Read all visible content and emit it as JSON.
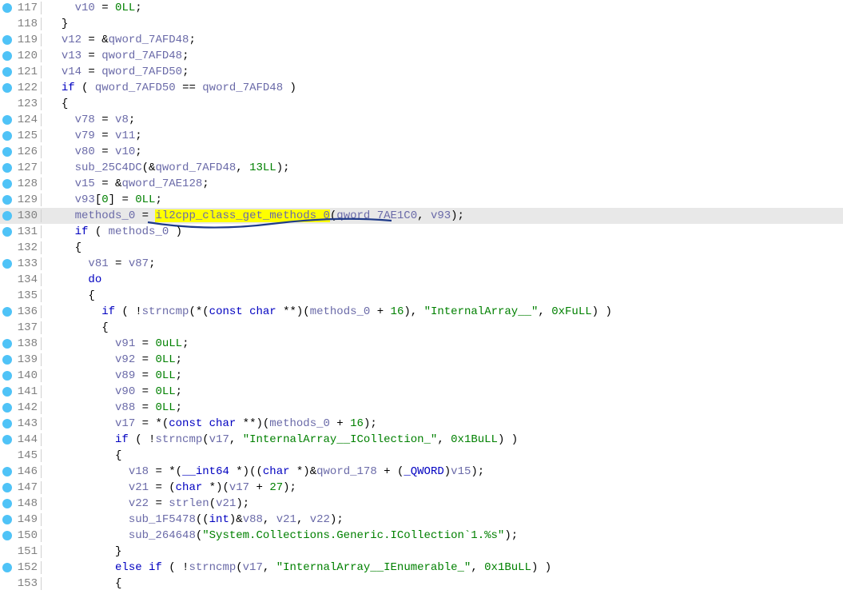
{
  "lines": [
    {
      "num": "117",
      "bp": true,
      "indent": "    ",
      "tokens": [
        {
          "t": "var",
          "v": "v10"
        },
        {
          "t": "op",
          "v": " = "
        },
        {
          "t": "num",
          "v": "0LL"
        },
        {
          "t": "pun",
          "v": ";"
        }
      ]
    },
    {
      "num": "118",
      "bp": false,
      "indent": "  ",
      "tokens": [
        {
          "t": "pun",
          "v": "}"
        }
      ]
    },
    {
      "num": "119",
      "bp": true,
      "indent": "  ",
      "tokens": [
        {
          "t": "var",
          "v": "v12"
        },
        {
          "t": "op",
          "v": " = &"
        },
        {
          "t": "var",
          "v": "qword_7AFD48"
        },
        {
          "t": "pun",
          "v": ";"
        }
      ]
    },
    {
      "num": "120",
      "bp": true,
      "indent": "  ",
      "tokens": [
        {
          "t": "var",
          "v": "v13"
        },
        {
          "t": "op",
          "v": " = "
        },
        {
          "t": "var",
          "v": "qword_7AFD48"
        },
        {
          "t": "pun",
          "v": ";"
        }
      ]
    },
    {
      "num": "121",
      "bp": true,
      "indent": "  ",
      "tokens": [
        {
          "t": "var",
          "v": "v14"
        },
        {
          "t": "op",
          "v": " = "
        },
        {
          "t": "var",
          "v": "qword_7AFD50"
        },
        {
          "t": "pun",
          "v": ";"
        }
      ]
    },
    {
      "num": "122",
      "bp": true,
      "indent": "  ",
      "tokens": [
        {
          "t": "kw",
          "v": "if"
        },
        {
          "t": "op",
          "v": " ( "
        },
        {
          "t": "var",
          "v": "qword_7AFD50"
        },
        {
          "t": "op",
          "v": " == "
        },
        {
          "t": "var",
          "v": "qword_7AFD48"
        },
        {
          "t": "op",
          "v": " )"
        }
      ]
    },
    {
      "num": "123",
      "bp": false,
      "indent": "  ",
      "tokens": [
        {
          "t": "pun",
          "v": "{"
        }
      ]
    },
    {
      "num": "124",
      "bp": true,
      "indent": "    ",
      "tokens": [
        {
          "t": "var",
          "v": "v78"
        },
        {
          "t": "op",
          "v": " = "
        },
        {
          "t": "var",
          "v": "v8"
        },
        {
          "t": "pun",
          "v": ";"
        }
      ]
    },
    {
      "num": "125",
      "bp": true,
      "indent": "    ",
      "tokens": [
        {
          "t": "var",
          "v": "v79"
        },
        {
          "t": "op",
          "v": " = "
        },
        {
          "t": "var",
          "v": "v11"
        },
        {
          "t": "pun",
          "v": ";"
        }
      ]
    },
    {
      "num": "126",
      "bp": true,
      "indent": "    ",
      "tokens": [
        {
          "t": "var",
          "v": "v80"
        },
        {
          "t": "op",
          "v": " = "
        },
        {
          "t": "var",
          "v": "v10"
        },
        {
          "t": "pun",
          "v": ";"
        }
      ]
    },
    {
      "num": "127",
      "bp": true,
      "indent": "    ",
      "tokens": [
        {
          "t": "fn",
          "v": "sub_25C4DC"
        },
        {
          "t": "pun",
          "v": "(&"
        },
        {
          "t": "var",
          "v": "qword_7AFD48"
        },
        {
          "t": "pun",
          "v": ", "
        },
        {
          "t": "num",
          "v": "13LL"
        },
        {
          "t": "pun",
          "v": ");"
        }
      ]
    },
    {
      "num": "128",
      "bp": true,
      "indent": "    ",
      "tokens": [
        {
          "t": "var",
          "v": "v15"
        },
        {
          "t": "op",
          "v": " = &"
        },
        {
          "t": "var",
          "v": "qword_7AE128"
        },
        {
          "t": "pun",
          "v": ";"
        }
      ]
    },
    {
      "num": "129",
      "bp": true,
      "indent": "    ",
      "tokens": [
        {
          "t": "var",
          "v": "v93"
        },
        {
          "t": "pun",
          "v": "["
        },
        {
          "t": "num",
          "v": "0"
        },
        {
          "t": "pun",
          "v": "] = "
        },
        {
          "t": "num",
          "v": "0LL"
        },
        {
          "t": "pun",
          "v": ";"
        }
      ]
    },
    {
      "num": "130",
      "bp": true,
      "highlighted": true,
      "indent": "    ",
      "tokens": [
        {
          "t": "var",
          "v": "methods_0"
        },
        {
          "t": "op",
          "v": " = "
        },
        {
          "t": "fn",
          "v": "il2cpp_class_get_methods_0",
          "hl": true
        },
        {
          "t": "pun",
          "v": "("
        },
        {
          "t": "var",
          "v": "qword_7AE1C0"
        },
        {
          "t": "pun",
          "v": ", "
        },
        {
          "t": "var",
          "v": "v93"
        },
        {
          "t": "pun",
          "v": ");"
        }
      ],
      "underline": true
    },
    {
      "num": "131",
      "bp": true,
      "indent": "    ",
      "tokens": [
        {
          "t": "kw",
          "v": "if"
        },
        {
          "t": "op",
          "v": " ( "
        },
        {
          "t": "var",
          "v": "methods_0"
        },
        {
          "t": "op",
          "v": " )"
        }
      ]
    },
    {
      "num": "132",
      "bp": false,
      "indent": "    ",
      "tokens": [
        {
          "t": "pun",
          "v": "{"
        }
      ]
    },
    {
      "num": "133",
      "bp": true,
      "indent": "      ",
      "tokens": [
        {
          "t": "var",
          "v": "v81"
        },
        {
          "t": "op",
          "v": " = "
        },
        {
          "t": "var",
          "v": "v87"
        },
        {
          "t": "pun",
          "v": ";"
        }
      ]
    },
    {
      "num": "134",
      "bp": false,
      "indent": "      ",
      "tokens": [
        {
          "t": "kw",
          "v": "do"
        }
      ]
    },
    {
      "num": "135",
      "bp": false,
      "indent": "      ",
      "tokens": [
        {
          "t": "pun",
          "v": "{"
        }
      ]
    },
    {
      "num": "136",
      "bp": true,
      "indent": "        ",
      "tokens": [
        {
          "t": "kw",
          "v": "if"
        },
        {
          "t": "op",
          "v": " ( !"
        },
        {
          "t": "fn",
          "v": "strncmp"
        },
        {
          "t": "pun",
          "v": "(*("
        },
        {
          "t": "type",
          "v": "const char"
        },
        {
          "t": "pun",
          "v": " **)("
        },
        {
          "t": "var",
          "v": "methods_0"
        },
        {
          "t": "op",
          "v": " + "
        },
        {
          "t": "num",
          "v": "16"
        },
        {
          "t": "pun",
          "v": "), "
        },
        {
          "t": "str",
          "v": "\"InternalArray__\""
        },
        {
          "t": "pun",
          "v": ", "
        },
        {
          "t": "num",
          "v": "0xFuLL"
        },
        {
          "t": "pun",
          "v": ") )"
        }
      ]
    },
    {
      "num": "137",
      "bp": false,
      "indent": "        ",
      "tokens": [
        {
          "t": "pun",
          "v": "{"
        }
      ]
    },
    {
      "num": "138",
      "bp": true,
      "indent": "          ",
      "tokens": [
        {
          "t": "var",
          "v": "v91"
        },
        {
          "t": "op",
          "v": " = "
        },
        {
          "t": "num",
          "v": "0uLL"
        },
        {
          "t": "pun",
          "v": ";"
        }
      ]
    },
    {
      "num": "139",
      "bp": true,
      "indent": "          ",
      "tokens": [
        {
          "t": "var",
          "v": "v92"
        },
        {
          "t": "op",
          "v": " = "
        },
        {
          "t": "num",
          "v": "0LL"
        },
        {
          "t": "pun",
          "v": ";"
        }
      ]
    },
    {
      "num": "140",
      "bp": true,
      "indent": "          ",
      "tokens": [
        {
          "t": "var",
          "v": "v89"
        },
        {
          "t": "op",
          "v": " = "
        },
        {
          "t": "num",
          "v": "0LL"
        },
        {
          "t": "pun",
          "v": ";"
        }
      ]
    },
    {
      "num": "141",
      "bp": true,
      "indent": "          ",
      "tokens": [
        {
          "t": "var",
          "v": "v90"
        },
        {
          "t": "op",
          "v": " = "
        },
        {
          "t": "num",
          "v": "0LL"
        },
        {
          "t": "pun",
          "v": ";"
        }
      ]
    },
    {
      "num": "142",
      "bp": true,
      "indent": "          ",
      "tokens": [
        {
          "t": "var",
          "v": "v88"
        },
        {
          "t": "op",
          "v": " = "
        },
        {
          "t": "num",
          "v": "0LL"
        },
        {
          "t": "pun",
          "v": ";"
        }
      ]
    },
    {
      "num": "143",
      "bp": true,
      "indent": "          ",
      "tokens": [
        {
          "t": "var",
          "v": "v17"
        },
        {
          "t": "op",
          "v": " = *("
        },
        {
          "t": "type",
          "v": "const char"
        },
        {
          "t": "pun",
          "v": " **)("
        },
        {
          "t": "var",
          "v": "methods_0"
        },
        {
          "t": "op",
          "v": " + "
        },
        {
          "t": "num",
          "v": "16"
        },
        {
          "t": "pun",
          "v": ");"
        }
      ]
    },
    {
      "num": "144",
      "bp": true,
      "indent": "          ",
      "tokens": [
        {
          "t": "kw",
          "v": "if"
        },
        {
          "t": "op",
          "v": " ( !"
        },
        {
          "t": "fn",
          "v": "strncmp"
        },
        {
          "t": "pun",
          "v": "("
        },
        {
          "t": "var",
          "v": "v17"
        },
        {
          "t": "pun",
          "v": ", "
        },
        {
          "t": "str",
          "v": "\"InternalArray__ICollection_\""
        },
        {
          "t": "pun",
          "v": ", "
        },
        {
          "t": "num",
          "v": "0x1BuLL"
        },
        {
          "t": "pun",
          "v": ") )"
        }
      ]
    },
    {
      "num": "145",
      "bp": false,
      "indent": "          ",
      "tokens": [
        {
          "t": "pun",
          "v": "{"
        }
      ]
    },
    {
      "num": "146",
      "bp": true,
      "indent": "            ",
      "tokens": [
        {
          "t": "var",
          "v": "v18"
        },
        {
          "t": "op",
          "v": " = *("
        },
        {
          "t": "type",
          "v": "__int64"
        },
        {
          "t": "pun",
          "v": " *)(("
        },
        {
          "t": "type",
          "v": "char"
        },
        {
          "t": "pun",
          "v": " *)&"
        },
        {
          "t": "var",
          "v": "qword_178"
        },
        {
          "t": "pun",
          "v": " + ("
        },
        {
          "t": "type",
          "v": "_QWORD"
        },
        {
          "t": "pun",
          "v": ")"
        },
        {
          "t": "var",
          "v": "v15"
        },
        {
          "t": "pun",
          "v": ");"
        }
      ]
    },
    {
      "num": "147",
      "bp": true,
      "indent": "            ",
      "tokens": [
        {
          "t": "var",
          "v": "v21"
        },
        {
          "t": "op",
          "v": " = ("
        },
        {
          "t": "type",
          "v": "char"
        },
        {
          "t": "pun",
          "v": " *)("
        },
        {
          "t": "var",
          "v": "v17"
        },
        {
          "t": "op",
          "v": " + "
        },
        {
          "t": "num",
          "v": "27"
        },
        {
          "t": "pun",
          "v": ");"
        }
      ]
    },
    {
      "num": "148",
      "bp": true,
      "indent": "            ",
      "tokens": [
        {
          "t": "var",
          "v": "v22"
        },
        {
          "t": "op",
          "v": " = "
        },
        {
          "t": "fn",
          "v": "strlen"
        },
        {
          "t": "pun",
          "v": "("
        },
        {
          "t": "var",
          "v": "v21"
        },
        {
          "t": "pun",
          "v": ");"
        }
      ]
    },
    {
      "num": "149",
      "bp": true,
      "indent": "            ",
      "tokens": [
        {
          "t": "fn",
          "v": "sub_1F5478"
        },
        {
          "t": "pun",
          "v": "(("
        },
        {
          "t": "type",
          "v": "int"
        },
        {
          "t": "pun",
          "v": ")&"
        },
        {
          "t": "var",
          "v": "v88"
        },
        {
          "t": "pun",
          "v": ", "
        },
        {
          "t": "var",
          "v": "v21"
        },
        {
          "t": "pun",
          "v": ", "
        },
        {
          "t": "var",
          "v": "v22"
        },
        {
          "t": "pun",
          "v": ");"
        }
      ]
    },
    {
      "num": "150",
      "bp": true,
      "indent": "            ",
      "tokens": [
        {
          "t": "fn",
          "v": "sub_264648"
        },
        {
          "t": "pun",
          "v": "("
        },
        {
          "t": "str",
          "v": "\"System.Collections.Generic.ICollection`1.%s\""
        },
        {
          "t": "pun",
          "v": ");"
        }
      ]
    },
    {
      "num": "151",
      "bp": false,
      "indent": "          ",
      "tokens": [
        {
          "t": "pun",
          "v": "}"
        }
      ]
    },
    {
      "num": "152",
      "bp": true,
      "indent": "          ",
      "tokens": [
        {
          "t": "kw",
          "v": "else if"
        },
        {
          "t": "op",
          "v": " ( !"
        },
        {
          "t": "fn",
          "v": "strncmp"
        },
        {
          "t": "pun",
          "v": "("
        },
        {
          "t": "var",
          "v": "v17"
        },
        {
          "t": "pun",
          "v": ", "
        },
        {
          "t": "str",
          "v": "\"InternalArray__IEnumerable_\""
        },
        {
          "t": "pun",
          "v": ", "
        },
        {
          "t": "num",
          "v": "0x1BuLL"
        },
        {
          "t": "pun",
          "v": ") )"
        }
      ]
    },
    {
      "num": "153",
      "bp": false,
      "indent": "          ",
      "tokens": [
        {
          "t": "pun",
          "v": "{"
        }
      ]
    }
  ]
}
